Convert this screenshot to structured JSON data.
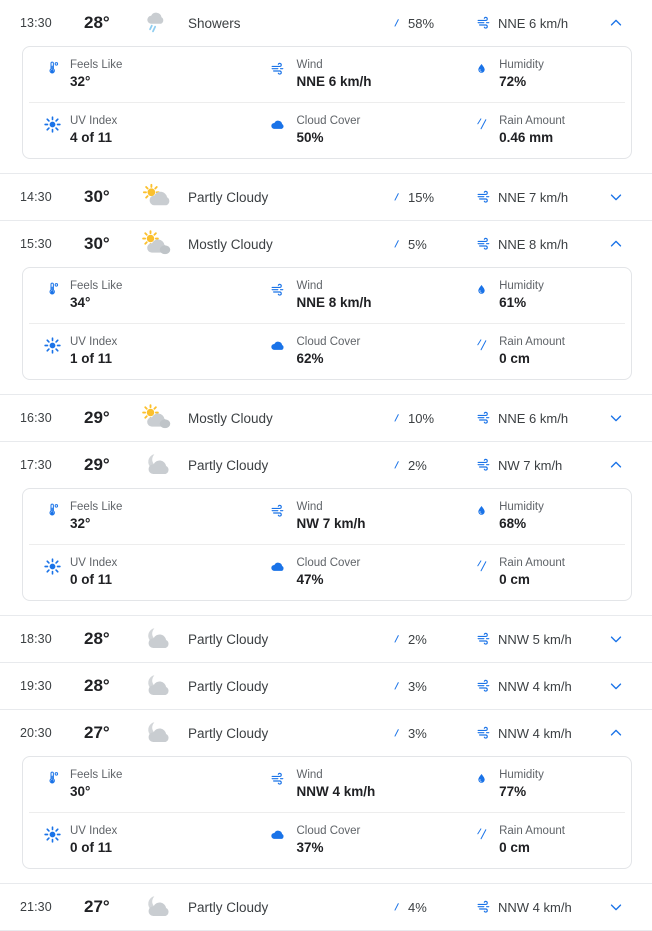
{
  "colors": {
    "accent_blue": "#1a73e8",
    "text_primary": "#202124",
    "text_secondary": "#5f6368",
    "cloud_gray": "#c9cdd1",
    "sun_yellow": "#fbc02d",
    "rain_light_blue": "#8ecdf0",
    "divider": "#e8eaed",
    "card_border": "#e3e5e8"
  },
  "labels": {
    "feels_like": "Feels Like",
    "wind": "Wind",
    "humidity": "Humidity",
    "uv_index": "UV Index",
    "cloud_cover": "Cloud Cover",
    "rain_amount": "Rain Amount"
  },
  "icons": {
    "precip": "raindrop-icon",
    "wind": "wind-icon",
    "chevron_down": "chevron-down-icon",
    "chevron_up": "chevron-up-icon",
    "feels_like": "thermometer-icon",
    "humidity": "humidity-drop-icon",
    "uv_index": "sun-burst-icon",
    "cloud_cover": "cloud-icon",
    "rain_amount": "rain-drops-icon"
  },
  "rows": [
    {
      "time": "13:30",
      "temp": "28°",
      "condition": "Showers",
      "condition_icon": "showers-icon",
      "precip": "58%",
      "wind": "NNE 6 km/h",
      "expanded": true,
      "chevron": "chevron-up-icon",
      "details": {
        "feels_like": "32°",
        "wind": "NNE 6 km/h",
        "humidity": "72%",
        "uv_index": "4 of 11",
        "cloud_cover": "50%",
        "rain_amount": "0.46 mm"
      }
    },
    {
      "time": "14:30",
      "temp": "30°",
      "condition": "Partly Cloudy",
      "condition_icon": "sun-cloud-icon",
      "precip": "15%",
      "wind": "NNE 7 km/h",
      "expanded": false,
      "chevron": "chevron-down-icon",
      "details": null
    },
    {
      "time": "15:30",
      "temp": "30°",
      "condition": "Mostly Cloudy",
      "condition_icon": "sun-cloud-double-icon",
      "precip": "5%",
      "wind": "NNE 8 km/h",
      "expanded": true,
      "chevron": "chevron-up-icon",
      "details": {
        "feels_like": "34°",
        "wind": "NNE 8 km/h",
        "humidity": "61%",
        "uv_index": "1 of 11",
        "cloud_cover": "62%",
        "rain_amount": "0 cm"
      }
    },
    {
      "time": "16:30",
      "temp": "29°",
      "condition": "Mostly Cloudy",
      "condition_icon": "sun-cloud-double-icon",
      "precip": "10%",
      "wind": "NNE 6 km/h",
      "expanded": false,
      "chevron": "chevron-down-icon",
      "details": null
    },
    {
      "time": "17:30",
      "temp": "29°",
      "condition": "Partly Cloudy",
      "condition_icon": "moon-cloud-icon",
      "precip": "2%",
      "wind": "NW 7 km/h",
      "expanded": true,
      "chevron": "chevron-up-icon",
      "details": {
        "feels_like": "32°",
        "wind": "NW 7 km/h",
        "humidity": "68%",
        "uv_index": "0 of 11",
        "cloud_cover": "47%",
        "rain_amount": "0 cm"
      }
    },
    {
      "time": "18:30",
      "temp": "28°",
      "condition": "Partly Cloudy",
      "condition_icon": "moon-cloud-icon",
      "precip": "2%",
      "wind": "NNW 5 km/h",
      "expanded": false,
      "chevron": "chevron-down-icon",
      "details": null
    },
    {
      "time": "19:30",
      "temp": "28°",
      "condition": "Partly Cloudy",
      "condition_icon": "moon-cloud-icon",
      "precip": "3%",
      "wind": "NNW 4 km/h",
      "expanded": false,
      "chevron": "chevron-down-icon",
      "details": null
    },
    {
      "time": "20:30",
      "temp": "27°",
      "condition": "Partly Cloudy",
      "condition_icon": "moon-cloud-icon",
      "precip": "3%",
      "wind": "NNW 4 km/h",
      "expanded": true,
      "chevron": "chevron-up-icon",
      "details": {
        "feels_like": "30°",
        "wind": "NNW 4 km/h",
        "humidity": "77%",
        "uv_index": "0 of 11",
        "cloud_cover": "37%",
        "rain_amount": "0 cm"
      }
    },
    {
      "time": "21:30",
      "temp": "27°",
      "condition": "Partly Cloudy",
      "condition_icon": "moon-cloud-icon",
      "precip": "4%",
      "wind": "NNW 4 km/h",
      "expanded": false,
      "chevron": "chevron-down-icon",
      "details": null
    }
  ]
}
